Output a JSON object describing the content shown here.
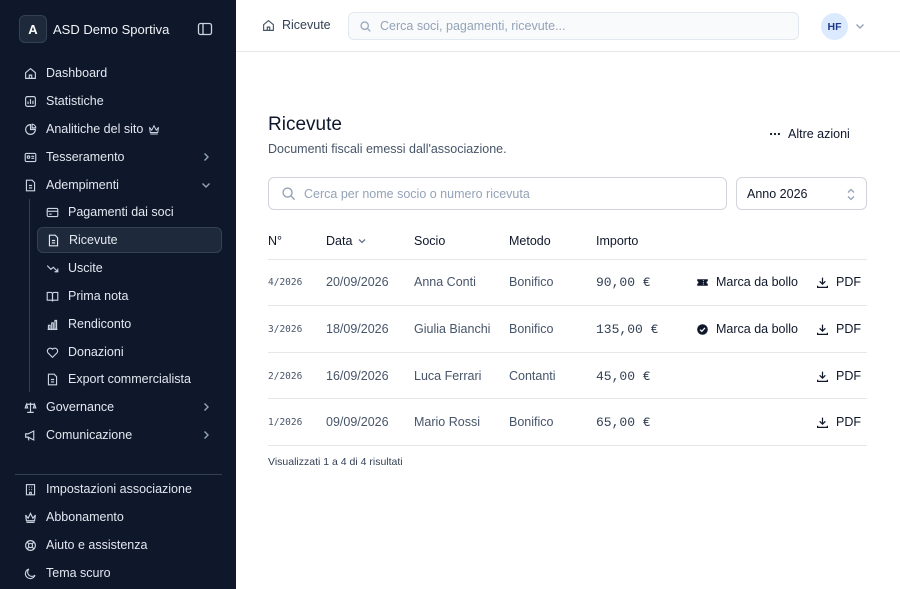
{
  "sidebar": {
    "brand_initial": "A",
    "brand_name": "ASD Demo Sportiva",
    "items": [
      {
        "label": "Dashboard"
      },
      {
        "label": "Statistiche"
      },
      {
        "label": "Analitiche del sito"
      },
      {
        "label": "Tesseramento"
      },
      {
        "label": "Adempimenti"
      },
      {
        "label": "Pagamenti dai soci"
      },
      {
        "label": "Ricevute"
      },
      {
        "label": "Uscite"
      },
      {
        "label": "Prima nota"
      },
      {
        "label": "Rendiconto"
      },
      {
        "label": "Donazioni"
      },
      {
        "label": "Export commercialista"
      },
      {
        "label": "Governance"
      },
      {
        "label": "Comunicazione"
      }
    ],
    "bottom": [
      {
        "label": "Impostazioni associazione"
      },
      {
        "label": "Abbonamento"
      },
      {
        "label": "Aiuto e assistenza"
      },
      {
        "label": "Tema scuro"
      }
    ]
  },
  "topbar": {
    "breadcrumb": "Ricevute",
    "search_placeholder": "Cerca soci, pagamenti, ricevute...",
    "avatar_initials": "HF"
  },
  "main": {
    "title": "Ricevute",
    "subtitle": "Documenti fiscali emessi dall'associazione.",
    "more_actions": "Altre azioni",
    "search_placeholder": "Cerca per nome socio o numero ricevuta",
    "year_selected": "Anno 2026",
    "columns": [
      "N°",
      "Data",
      "Socio",
      "Metodo",
      "Importo"
    ],
    "rows": [
      {
        "num": "4/2026",
        "date": "20/09/2026",
        "member": "Anna Conti",
        "method": "Bonifico",
        "amount": "90,00 €",
        "stamp": "Marca da bollo",
        "pdf": "PDF"
      },
      {
        "num": "3/2026",
        "date": "18/09/2026",
        "member": "Giulia Bianchi",
        "method": "Bonifico",
        "amount": "135,00 €",
        "stamp": "Marca da bollo",
        "pdf": "PDF"
      },
      {
        "num": "2/2026",
        "date": "16/09/2026",
        "member": "Luca Ferrari",
        "method": "Contanti",
        "amount": "45,00 €",
        "pdf": "PDF"
      },
      {
        "num": "1/2026",
        "date": "09/09/2026",
        "member": "Mario Rossi",
        "method": "Bonifico",
        "amount": "65,00 €",
        "pdf": "PDF"
      }
    ],
    "footer": "Visualizzati 1 a 4 di 4 risultati"
  },
  "colors": {
    "sidebar_bg": "#0f172a",
    "sidebar_active_bg": "#1e293b",
    "avatar_bg": "#dbeafe",
    "accent": "#1e3a8a"
  }
}
